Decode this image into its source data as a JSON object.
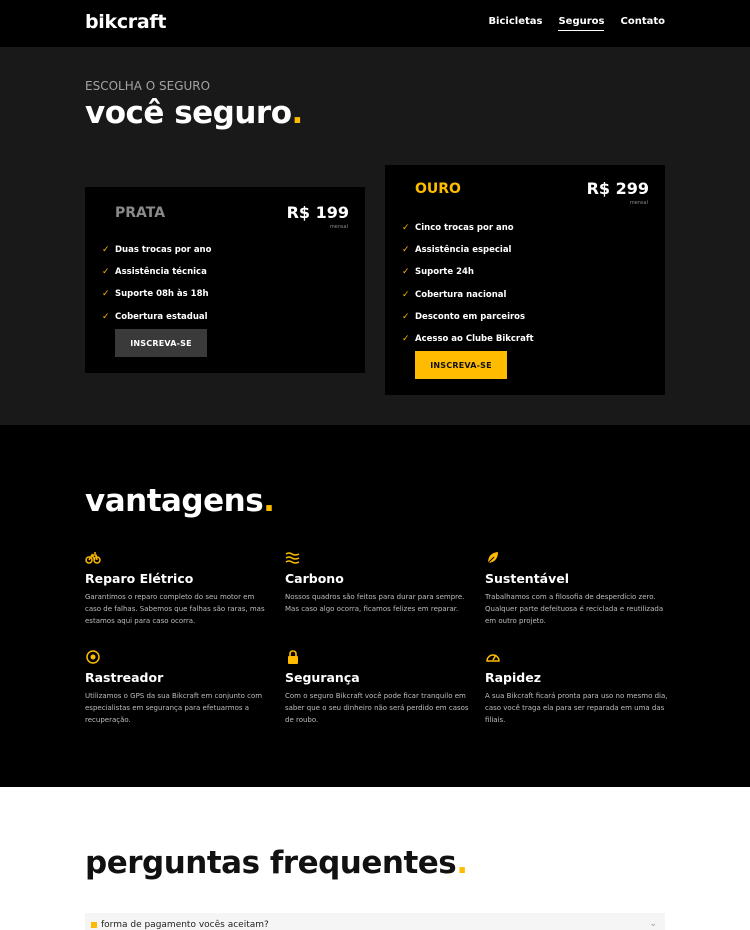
{
  "header": {
    "logo": "bikcraft",
    "nav": [
      "Bicicletas",
      "Seguros",
      "Contato"
    ]
  },
  "hero": {
    "subtitle": "ESCOLHA O SEGURO",
    "title": "você seguro",
    "title_dot": "."
  },
  "plans": [
    {
      "name": "PRATA",
      "price": "R$ 199",
      "period": "mensal",
      "features": [
        "Duas trocas por ano",
        "Assistência técnica",
        "Suporte 08h às 18h",
        "Cobertura estadual"
      ],
      "button": "INSCREVA-SE"
    },
    {
      "name": "OURO",
      "price": "R$ 299",
      "period": "mensal",
      "features": [
        "Cinco trocas por ano",
        "Assistência especial",
        "Suporte 24h",
        "Cobertura nacional",
        "Desconto em parceiros",
        "Acesso ao Clube Bikcraft"
      ],
      "button": "INSCREVA-SE"
    }
  ],
  "vantagens": {
    "title": "vantagens",
    "title_dot": ".",
    "items": [
      {
        "icon": "bike-icon",
        "name": "Reparo Elétrico",
        "desc": "Garantimos o reparo completo do seu motor em caso de falhas. Sabemos que falhas são raras, mas estamos aqui para caso ocorra."
      },
      {
        "icon": "waves-icon",
        "name": "Carbono",
        "desc": "Nossos quadros são feitos para durar para sempre. Mas caso algo ocorra, ficamos felizes em reparar."
      },
      {
        "icon": "leaf-icon",
        "name": "Sustentável",
        "desc": "Trabalhamos com a filosofia de desperdício zero. Qualquer parte defeituosa é reciclada e reutilizada em outro projeto."
      },
      {
        "icon": "target-icon",
        "name": "Rastreador",
        "desc": "Utilizamos o GPS da sua Bikcraft em conjunto com especialistas em segurança para efetuarmos a recuperação."
      },
      {
        "icon": "lock-icon",
        "name": "Segurança",
        "desc": "Com o seguro Bikcraft você pode ficar tranquilo em saber que o seu dinheiro não será perdido em casos de roubo."
      },
      {
        "icon": "speedometer-icon",
        "name": "Rapidez",
        "desc": "A sua Bikcraft ficará pronta para uso no mesmo dia, caso você traga ela para ser reparada em uma das filiais."
      }
    ]
  },
  "faq": {
    "title": "perguntas frequentes",
    "title_dot": ".",
    "first_question": "forma de pagamento vocês aceitam?"
  },
  "colors": {
    "accent": "#FFBB00",
    "header_bg": "#000000",
    "hero_bg": "#191919",
    "card_bg": "#000000",
    "faq_bg": "#FFFFFF"
  }
}
